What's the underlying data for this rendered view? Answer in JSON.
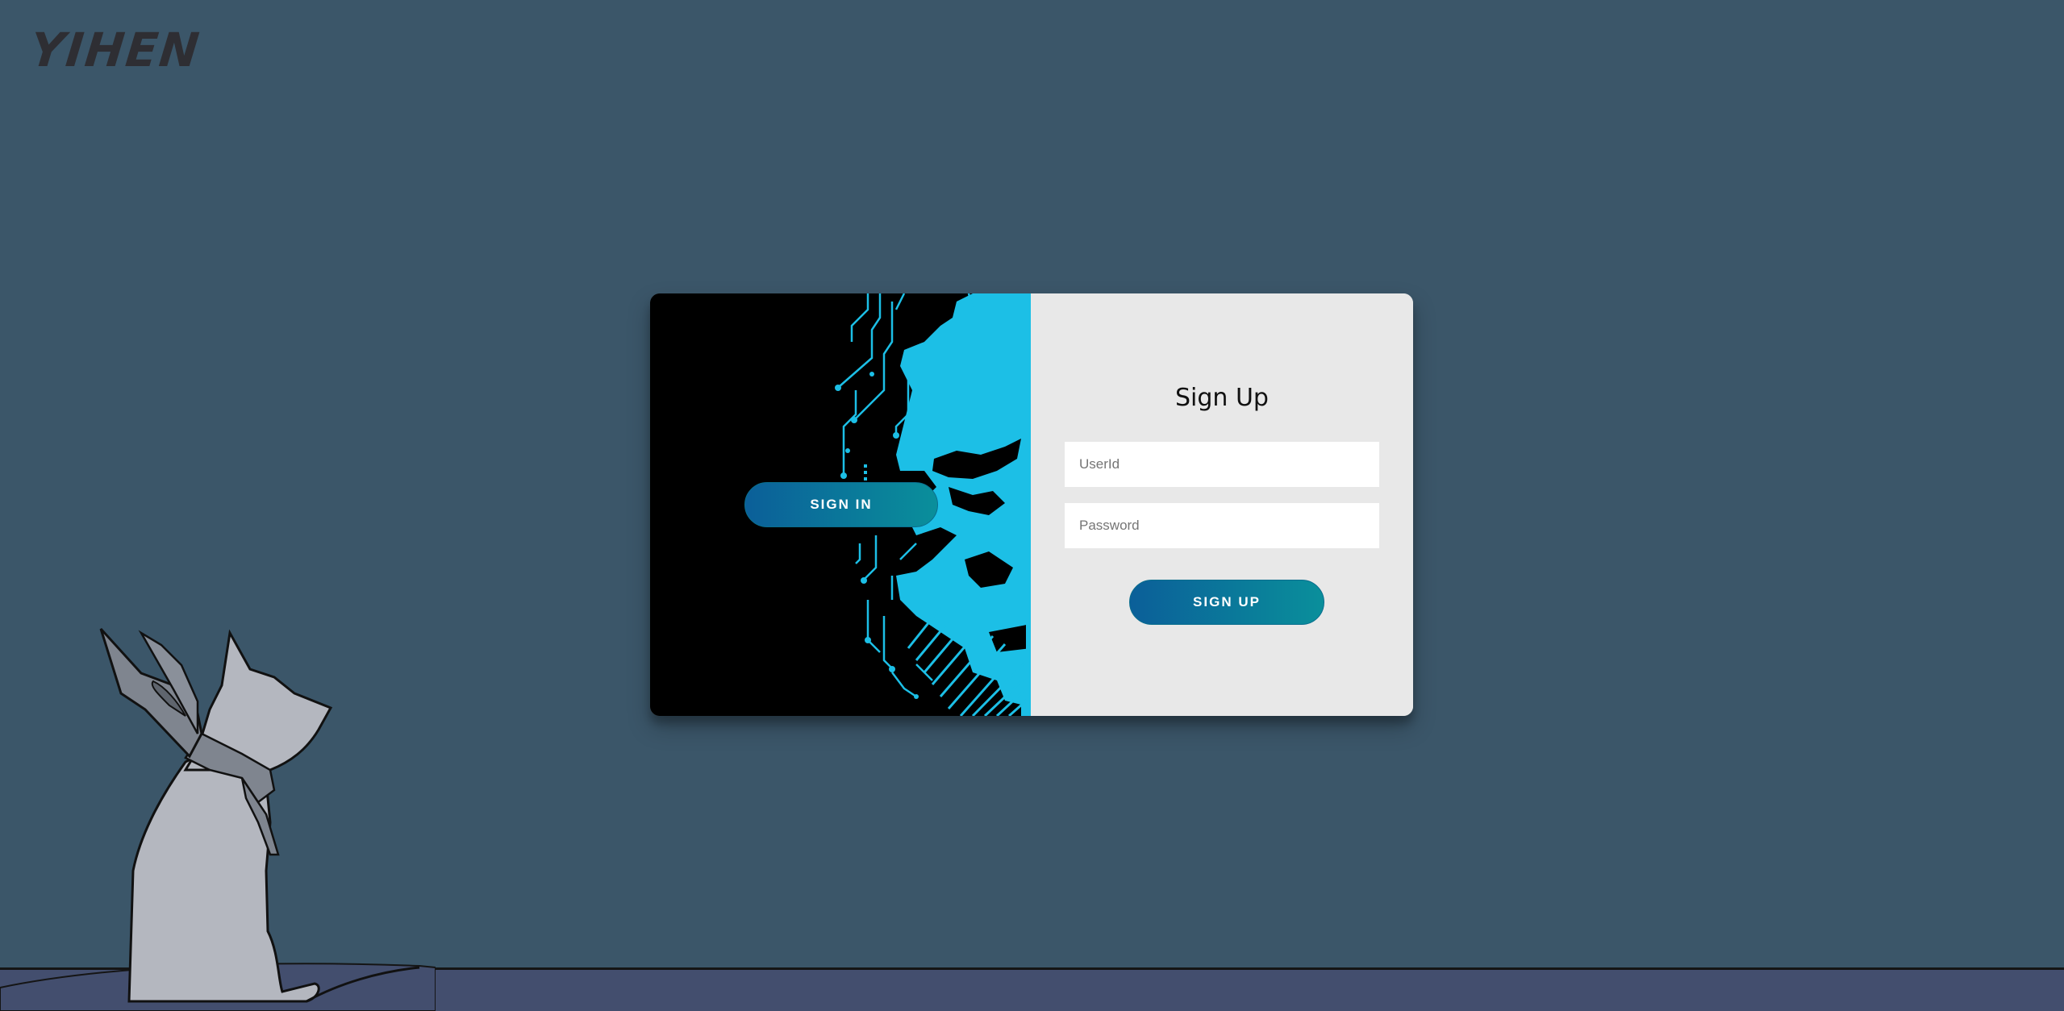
{
  "brand": {
    "logo_text": "YIHEN"
  },
  "signin_panel": {
    "signin_label": "SIGN IN"
  },
  "signup_form": {
    "title": "Sign Up",
    "userid_placeholder": "UserId",
    "userid_value": "",
    "password_placeholder": "Password",
    "password_value": "",
    "signup_label": "SIGN UP"
  },
  "colors": {
    "background": "#3b5669",
    "card_background": "#e8e8e8",
    "art_cyan": "#1cbfe6",
    "button_gradient_start": "#0b5f99",
    "button_gradient_end": "#0a8f9b",
    "floor": "#434e6e"
  },
  "icons": {
    "logo": "brush-script-logo",
    "hero_art": "circuit-face-illustration",
    "mascot": "cat-with-scarf-illustration"
  }
}
